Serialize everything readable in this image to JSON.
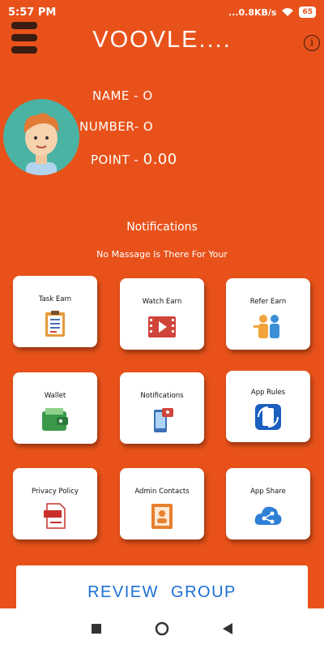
{
  "status_bar": {
    "time": "5:57 PM",
    "network": "...0.8KB/s",
    "battery": "65"
  },
  "header": {
    "title": "VOOVLE...."
  },
  "profile": {
    "name": "NAME - O",
    "number": "NUMBER- O",
    "point_label": "POINT -",
    "point_value": "0.00"
  },
  "notifications": {
    "title": "Notifications",
    "message": "No Massage Is There For Your"
  },
  "tiles": [
    {
      "label": "Task Earn",
      "icon": "clipboard-icon"
    },
    {
      "label": "Watch Earn",
      "icon": "video-icon"
    },
    {
      "label": "Refer Earn",
      "icon": "refer-icon"
    },
    {
      "label": "Wallet",
      "icon": "wallet-icon"
    },
    {
      "label": "Notifications",
      "icon": "phone-notification-icon"
    },
    {
      "label": "App Rules",
      "icon": "rules-icon"
    },
    {
      "label": "Privacy Policy",
      "icon": "document-icon"
    },
    {
      "label": "Admin Contacts",
      "icon": "contacts-icon"
    },
    {
      "label": "App Share",
      "icon": "share-cloud-icon"
    }
  ],
  "review": {
    "label": "REVIEW GROUP"
  },
  "colors": {
    "background": "#e8521a",
    "accent_text": "#1a6fd6"
  }
}
